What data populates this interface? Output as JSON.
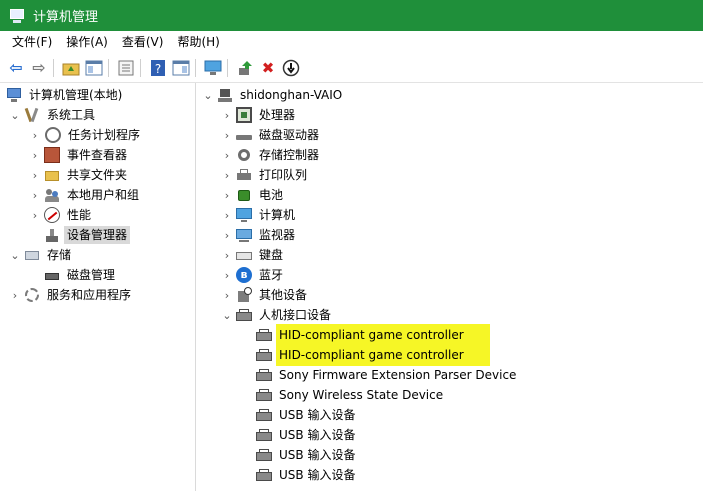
{
  "window": {
    "title": "计算机管理"
  },
  "menu": [
    "文件(F)",
    "操作(A)",
    "查看(V)",
    "帮助(H)"
  ],
  "toolbar": {
    "icons": [
      "back-arrow-icon",
      "forward-arrow-icon",
      "up-folder-icon",
      "show-hide-tree-icon",
      "export-list-icon",
      "help-icon",
      "action-pane-icon",
      "computer-icon",
      "update-driver-icon",
      "uninstall-icon",
      "disable-device-icon"
    ],
    "back_glyph": "⇦",
    "forward_glyph": "⇨",
    "delete_glyph": "✖",
    "help_glyph": "?"
  },
  "left_tree": {
    "root": "计算机管理(本地)",
    "system_tools": "系统工具",
    "task_scheduler": "任务计划程序",
    "event_viewer": "事件查看器",
    "shared_folders": "共享文件夹",
    "local_users": "本地用户和组",
    "performance": "性能",
    "device_manager": "设备管理器",
    "storage": "存储",
    "disk_management": "磁盘管理",
    "services_apps": "服务和应用程序"
  },
  "device_tree": {
    "host": "shidonghan-VAIO",
    "categories": {
      "processors": "处理器",
      "disk_drives": "磁盘驱动器",
      "storage_controllers": "存储控制器",
      "print_queues": "打印队列",
      "batteries": "电池",
      "computer": "计算机",
      "monitors": "监视器",
      "keyboards": "键盘",
      "bluetooth": "蓝牙",
      "other_devices": "其他设备",
      "hid": "人机接口设备"
    },
    "hid_devices": [
      "HID-compliant game controller",
      "HID-compliant game controller",
      "Sony Firmware Extension Parser Device",
      "Sony Wireless State Device",
      "USB 输入设备",
      "USB 输入设备",
      "USB 输入设备",
      "USB 输入设备"
    ],
    "highlight_color": "#f6f626"
  },
  "colors": {
    "titlebar": "#1f8f3a",
    "selection": "#d9d9d9"
  }
}
